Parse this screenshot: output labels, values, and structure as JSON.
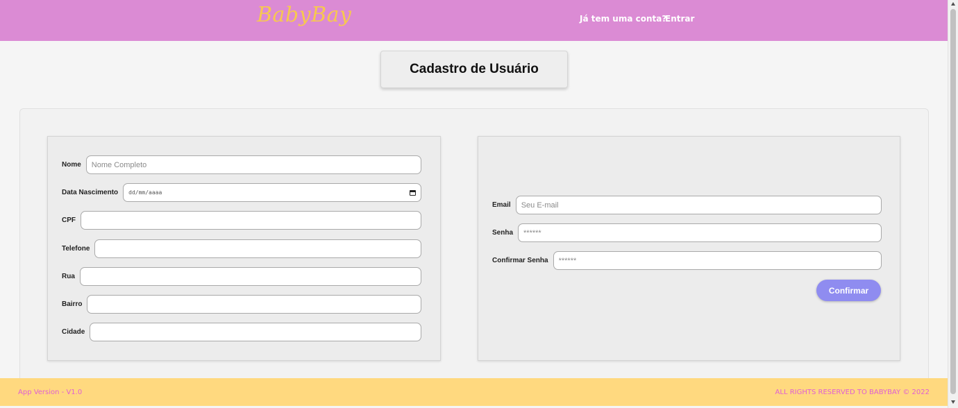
{
  "header": {
    "logo": "BabyBay",
    "question": "Já tem uma conta?",
    "login_link": "Entrar"
  },
  "page_title": "Cadastro de Usuário",
  "form_left": {
    "name_label": "Nome",
    "name_placeholder": "Nome Completo",
    "birth_label": "Data Nascimento",
    "birth_placeholder": "dd/mm/aaaa",
    "cpf_label": "CPF",
    "phone_label": "Telefone",
    "street_label": "Rua",
    "neighborhood_label": "Bairro",
    "city_label": "Cidade"
  },
  "form_right": {
    "email_label": "Email",
    "email_placeholder": "Seu E-mail",
    "password_label": "Senha",
    "password_placeholder": "******",
    "confirm_password_label": "Confirmar Senha",
    "confirm_password_placeholder": "******",
    "confirm_button": "Confirmar"
  },
  "footer": {
    "version": "App Version - V1.0",
    "rights": "ALL RIGHTS RESERVED TO BABYBAY © 2022"
  },
  "colors": {
    "header_bg": "#db8bd4",
    "logo": "#f7c84f",
    "footer_bg": "#ffd97f",
    "footer_text": "#e05fd3",
    "button": "#8f8cf0"
  },
  "icons": {
    "date_picker": "calendar-icon"
  }
}
